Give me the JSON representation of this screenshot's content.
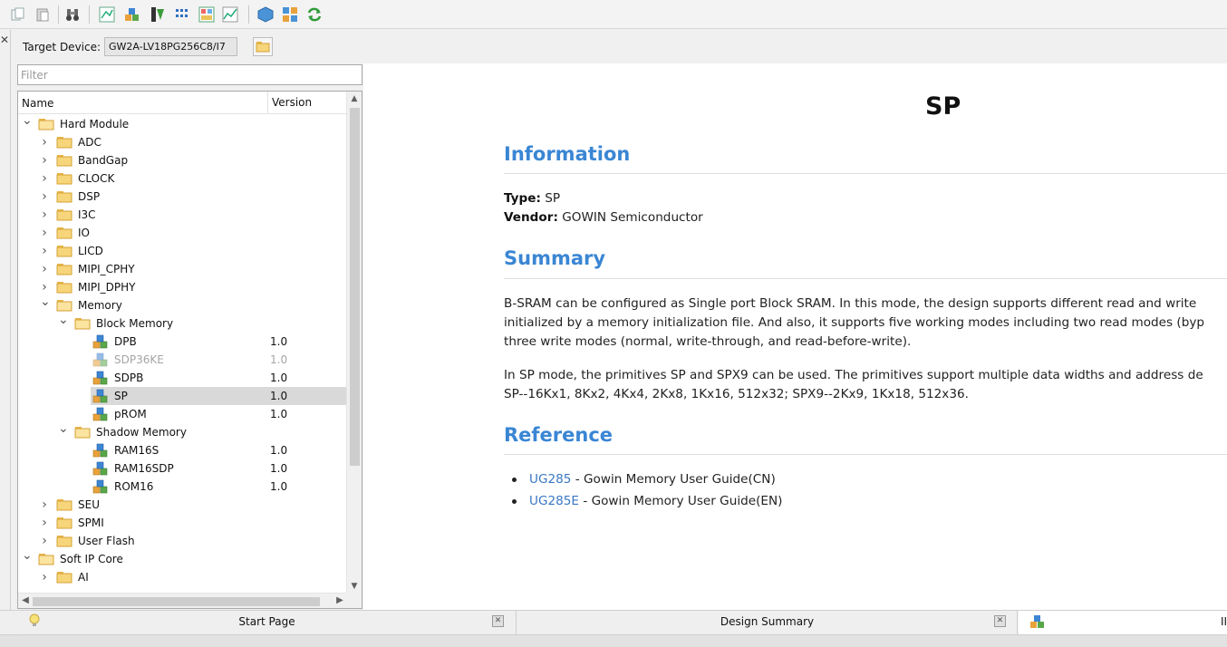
{
  "target_device": {
    "label": "Target Device:",
    "value": "GW2A-LV18PG256C8/I7"
  },
  "filter": {
    "placeholder": "Filter"
  },
  "tree": {
    "columns": [
      "Name",
      "Version"
    ],
    "rows": [
      {
        "label": "Hard Module",
        "version": "",
        "level": 0,
        "expand": "open",
        "icon": "folder-open"
      },
      {
        "label": "ADC",
        "version": "",
        "level": 1,
        "expand": "closed",
        "icon": "folder"
      },
      {
        "label": "BandGap",
        "version": "",
        "level": 1,
        "expand": "closed",
        "icon": "folder"
      },
      {
        "label": "CLOCK",
        "version": "",
        "level": 1,
        "expand": "closed",
        "icon": "folder"
      },
      {
        "label": "DSP",
        "version": "",
        "level": 1,
        "expand": "closed",
        "icon": "folder"
      },
      {
        "label": "I3C",
        "version": "",
        "level": 1,
        "expand": "closed",
        "icon": "folder"
      },
      {
        "label": "IO",
        "version": "",
        "level": 1,
        "expand": "closed",
        "icon": "folder"
      },
      {
        "label": "LICD",
        "version": "",
        "level": 1,
        "expand": "closed",
        "icon": "folder"
      },
      {
        "label": "MIPI_CPHY",
        "version": "",
        "level": 1,
        "expand": "closed",
        "icon": "folder"
      },
      {
        "label": "MIPI_DPHY",
        "version": "",
        "level": 1,
        "expand": "closed",
        "icon": "folder"
      },
      {
        "label": "Memory",
        "version": "",
        "level": 1,
        "expand": "open",
        "icon": "folder-open"
      },
      {
        "label": "Block Memory",
        "version": "",
        "level": 2,
        "expand": "open",
        "icon": "folder-open"
      },
      {
        "label": "DPB",
        "version": "1.0",
        "level": 3,
        "expand": "none",
        "icon": "ip-cubes"
      },
      {
        "label": "SDP36KE",
        "version": "1.0",
        "level": 3,
        "expand": "none",
        "icon": "ip-cubes",
        "disabled": true
      },
      {
        "label": "SDPB",
        "version": "1.0",
        "level": 3,
        "expand": "none",
        "icon": "ip-cubes"
      },
      {
        "label": "SP",
        "version": "1.0",
        "level": 3,
        "expand": "none",
        "icon": "ip-cubes",
        "selected": true
      },
      {
        "label": "pROM",
        "version": "1.0",
        "level": 3,
        "expand": "none",
        "icon": "ip-cubes"
      },
      {
        "label": "Shadow Memory",
        "version": "",
        "level": 2,
        "expand": "open",
        "icon": "folder-open"
      },
      {
        "label": "RAM16S",
        "version": "1.0",
        "level": 3,
        "expand": "none",
        "icon": "ip-cubes"
      },
      {
        "label": "RAM16SDP",
        "version": "1.0",
        "level": 3,
        "expand": "none",
        "icon": "ip-cubes"
      },
      {
        "label": "ROM16",
        "version": "1.0",
        "level": 3,
        "expand": "none",
        "icon": "ip-cubes"
      },
      {
        "label": "SEU",
        "version": "",
        "level": 1,
        "expand": "closed",
        "icon": "folder"
      },
      {
        "label": "SPMI",
        "version": "",
        "level": 1,
        "expand": "closed",
        "icon": "folder"
      },
      {
        "label": "User Flash",
        "version": "",
        "level": 1,
        "expand": "closed",
        "icon": "folder"
      },
      {
        "label": "Soft IP Core",
        "version": "",
        "level": 0,
        "expand": "open",
        "icon": "folder-open"
      },
      {
        "label": "AI",
        "version": "",
        "level": 1,
        "expand": "closed",
        "icon": "folder"
      }
    ]
  },
  "doc": {
    "title": "SP",
    "information_heading": "Information",
    "type_label": "Type:",
    "type_value": "SP",
    "vendor_label": "Vendor:",
    "vendor_value": "GOWIN Semiconductor",
    "summary_heading": "Summary",
    "summary_lines": [
      "B-SRAM can be configured as Single port Block SRAM. In this mode, the design supports different read and write",
      "initialized by a memory initialization file. And also, it supports five working modes including two read modes (byp",
      "three write modes (normal, write-through, and read-before-write)."
    ],
    "summary_lines_2": [
      "In SP mode, the primitives SP and SPX9 can be used. The primitives support multiple data widths and address de",
      "SP--16Kx1, 8Kx2, 4Kx4, 2Kx8, 1Kx16, 512x32; SPX9--2Kx9, 1Kx18, 512x36."
    ],
    "reference_heading": "Reference",
    "references": [
      {
        "link": "UG285",
        "text": " - Gowin Memory User Guide(CN)"
      },
      {
        "link": "UG285E",
        "text": " - Gowin Memory User Guide(EN)"
      }
    ]
  },
  "bottom_tabs": [
    {
      "title": "Start Page",
      "icon": "lightbulb-icon"
    },
    {
      "title": "Design Summary",
      "icon": ""
    },
    {
      "title": "II",
      "icon": "ip-cubes-icon"
    }
  ],
  "colors": {
    "heading": "#3a86d4",
    "link": "#3a78c4",
    "selection": "#d9d9d9"
  }
}
